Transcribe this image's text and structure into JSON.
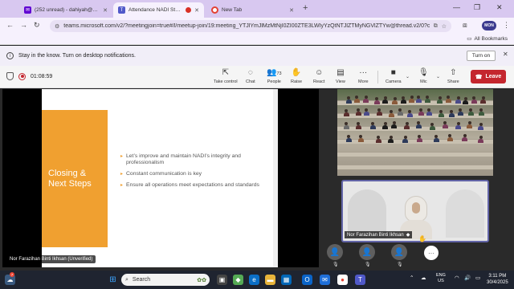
{
  "browser": {
    "tabs": [
      {
        "label": "(252 unread) - dahiyah@sprin...",
        "icon": "yahoo-mail-icon"
      },
      {
        "label": "Attendance NADI Staff | Me...",
        "icon": "teams-icon",
        "active": true
      },
      {
        "label": "New Tab",
        "icon": "chrome-icon"
      }
    ],
    "url": "teams.microsoft.com/v2/?meetingjoin=true#/l/meetup-join/19:meeting_YTJlYmJlMzMtNjI0ZI00ZTE3LWIyYzQtNTJlZTMyNGVlZTYw@thread.v2/0?c...",
    "profile_label": "MON",
    "bookmarks_label": "All Bookmarks"
  },
  "notification": {
    "message": "Stay in the know. Turn on desktop notifications.",
    "turn_on_label": "Turn on"
  },
  "meeting": {
    "timer": "01:08:59",
    "toolbar": [
      {
        "label": "Take control",
        "icon": "take-control-icon"
      },
      {
        "label": "Chat",
        "icon": "chat-icon"
      },
      {
        "label": "People",
        "icon": "people-icon",
        "count": "73"
      },
      {
        "label": "Raise",
        "icon": "raise-hand-icon"
      },
      {
        "label": "React",
        "icon": "react-icon"
      },
      {
        "label": "View",
        "icon": "view-icon"
      },
      {
        "label": "More",
        "icon": "more-icon"
      },
      {
        "label": "Camera",
        "icon": "camera-icon"
      },
      {
        "label": "Mic",
        "icon": "mic-off-icon"
      },
      {
        "label": "Share",
        "icon": "share-icon"
      }
    ],
    "leave_label": "Leave",
    "accent": "#6264a7",
    "leave_color": "#c4262e"
  },
  "slide": {
    "title_line1": "Closing &",
    "title_line2": "Next Steps",
    "bullets": [
      "Let’s improve and maintain NADI’s integrity and professionalism",
      "Constant communication is key",
      "Ensure all operations meet expectations and standards"
    ],
    "accent": "#f0a030",
    "presenter": "Nor Farazihan Binti Ikhsan (Unverified)"
  },
  "speaker": {
    "name": "Nor Farazihan Binti Ikhsan"
  },
  "taskbar": {
    "search_placeholder": "Search",
    "lang_line1": "ENG",
    "lang_line2": "US",
    "time": "3:11 PM",
    "date": "30/4/2025",
    "badge": "7"
  }
}
